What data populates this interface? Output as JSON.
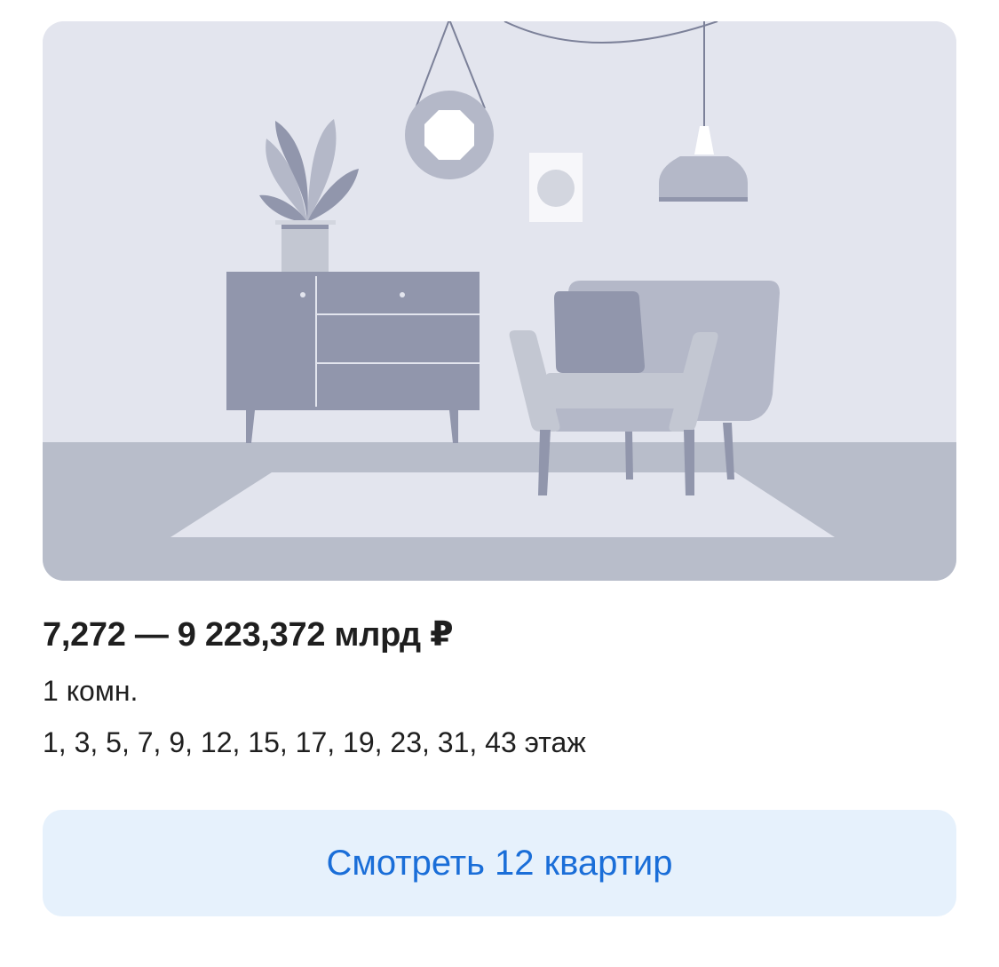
{
  "listing": {
    "illustration": {
      "name": "room-placeholder-illustration",
      "colors": {
        "wall": "#e3e5ee",
        "floor": "#b8bdca",
        "rug": "#e3e5ee",
        "furniture_dark": "#9196ac",
        "furniture_light": "#b4b8c8",
        "accent_light": "#c3c7d2"
      }
    },
    "price_range": "7,272 — 9 223,372 млрд ₽",
    "rooms": "1 комн.",
    "floors": "1, 3, 5, 7, 9, 12, 15, 17, 19, 23, 31, 43 этаж",
    "cta": {
      "label": "Смотреть 12 квартир",
      "color": "#1a6ed8",
      "background": "#e6f1fc"
    }
  }
}
